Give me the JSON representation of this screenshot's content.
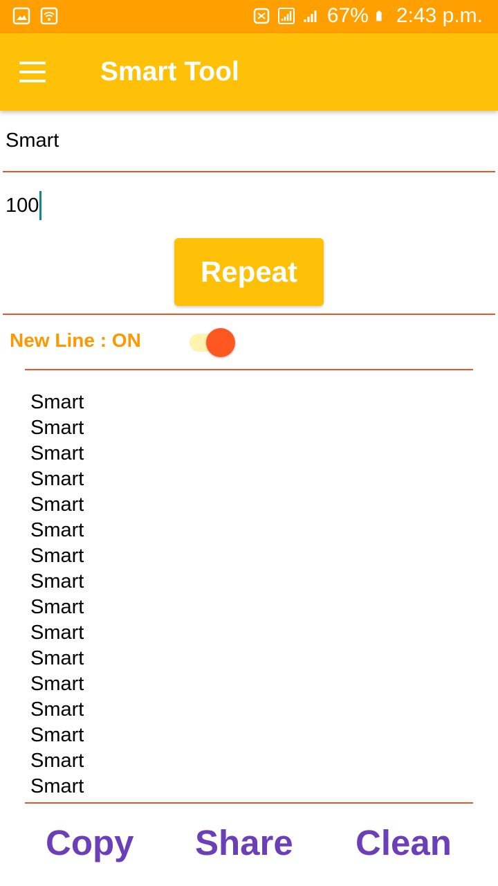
{
  "status_bar": {
    "battery": "67%",
    "time": "2:43 p.m."
  },
  "app_bar": {
    "title": "Smart Tool"
  },
  "form": {
    "text_value": "Smart",
    "count_value": "100",
    "repeat_label": "Repeat"
  },
  "options": {
    "new_line_label": "New Line : ON",
    "new_line_on": true
  },
  "output": {
    "lines": [
      "Smart",
      "Smart",
      "Smart",
      "Smart",
      "Smart",
      "Smart",
      "Smart",
      "Smart",
      "Smart",
      "Smart",
      "Smart",
      "Smart",
      "Smart",
      "Smart",
      "Smart",
      "Smart"
    ]
  },
  "actions": {
    "copy": "Copy",
    "share": "Share",
    "clean": "Clean"
  },
  "colors": {
    "status_bar": "#FF9F00",
    "app_bar": "#FFC107",
    "divider": "#E8532B",
    "label": "#FF9800",
    "toggle_thumb": "#FF5722",
    "action_text": "#6A3FB8"
  }
}
